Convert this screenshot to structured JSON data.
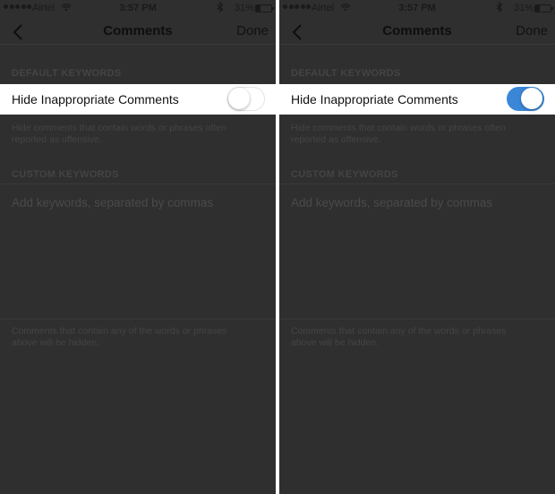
{
  "panels": [
    {
      "status": {
        "carrier": "Airtel",
        "time": "3:57 PM",
        "battery": "31%",
        "battery_level": 0.31
      },
      "nav": {
        "title": "Comments",
        "done": "Done"
      },
      "default_header": "DEFAULT KEYWORDS",
      "toggle_label": "Hide Inappropriate Comments",
      "toggle_on": false,
      "default_hint": "Hide comments that contain words or phrases often reported as offensive.",
      "custom_header": "CUSTOM KEYWORDS",
      "custom_placeholder": "Add keywords, separated by commas",
      "custom_hint": "Comments that contain any of the words or phrases above will be hidden."
    },
    {
      "status": {
        "carrier": "Airtel",
        "time": "3:57 PM",
        "battery": "31%",
        "battery_level": 0.31
      },
      "nav": {
        "title": "Comments",
        "done": "Done"
      },
      "default_header": "DEFAULT KEYWORDS",
      "toggle_label": "Hide Inappropriate Comments",
      "toggle_on": true,
      "default_hint": "Hide comments that contain words or phrases often reported as offensive.",
      "custom_header": "CUSTOM KEYWORDS",
      "custom_placeholder": "Add keywords, separated by commas",
      "custom_hint": "Comments that contain any of the words or phrases above will be hidden."
    }
  ],
  "icons": {
    "back": "chevron-left-icon",
    "wifi": "wifi-icon",
    "bluetooth": "bluetooth-icon",
    "battery": "battery-icon"
  },
  "colors": {
    "toggle_on": "#3a87d8",
    "overlay": "#2f2f2f"
  }
}
